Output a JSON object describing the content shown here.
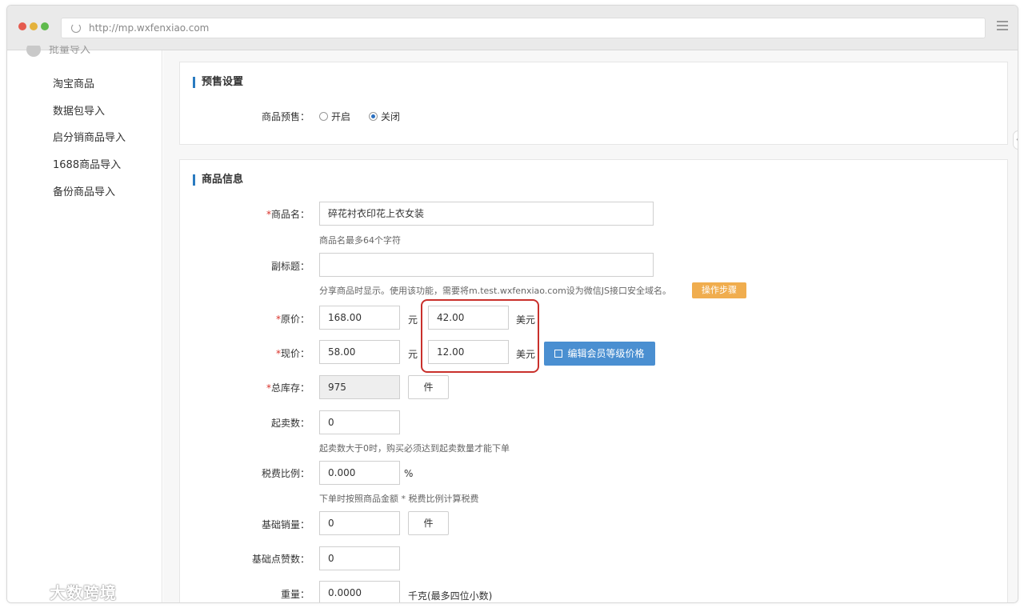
{
  "browser": {
    "url": "http://mp.wxfenxiao.com"
  },
  "sidebar": {
    "top_partial_label": "批量导入",
    "items": [
      {
        "label": "淘宝商品"
      },
      {
        "label": "数据包导入"
      },
      {
        "label": "启分销商品导入"
      },
      {
        "label": "1688商品导入"
      },
      {
        "label": "备份商品导入"
      }
    ]
  },
  "presale": {
    "title": "预售设置",
    "label": "商品预售：",
    "options": [
      {
        "label": "开启",
        "selected": false
      },
      {
        "label": "关闭",
        "selected": true
      }
    ]
  },
  "info": {
    "title": "商品信息",
    "name": {
      "label": "商品名：",
      "value": "碎花衬衣印花上衣女装",
      "hint": "商品名最多64个字符"
    },
    "subtitle": {
      "label": "副标题：",
      "value": "",
      "hint": "分享商品时显示。使用该功能，需要将m.test.wxfenxiao.com设为微信JS接口安全域名。",
      "button": "操作步骤"
    },
    "original_price": {
      "label": "原价：",
      "value": "168.00",
      "unit": "元",
      "usd_value": "42.00",
      "usd_unit": "美元"
    },
    "current_price": {
      "label": "现价：",
      "value": "58.00",
      "unit": "元",
      "usd_value": "12.00",
      "usd_unit": "美元",
      "button": "编辑会员等级价格"
    },
    "stock": {
      "label": "总库存：",
      "value": "975",
      "unit_button": "件"
    },
    "min_qty": {
      "label": "起卖数：",
      "value": "0",
      "hint": "起卖数大于0时，购买必须达到起卖数量才能下单"
    },
    "tax": {
      "label": "税费比例：",
      "value": "0.000",
      "unit": "%",
      "hint": "下单时按照商品金额 * 税费比例计算税费"
    },
    "base_sales": {
      "label": "基础销量：",
      "value": "0",
      "unit_button": "件"
    },
    "base_likes": {
      "label": "基础点赞数：",
      "value": "0"
    },
    "weight": {
      "label": "重量：",
      "value": "0.0000",
      "unit": "千克(最多四位小数)"
    }
  },
  "watermark": {
    "text": "大数跨境"
  },
  "colors": {
    "accent_blue": "#4a8fd1",
    "orange": "#f0ad4e",
    "required_red": "#d9332b",
    "highlight_red": "#c9302c"
  }
}
